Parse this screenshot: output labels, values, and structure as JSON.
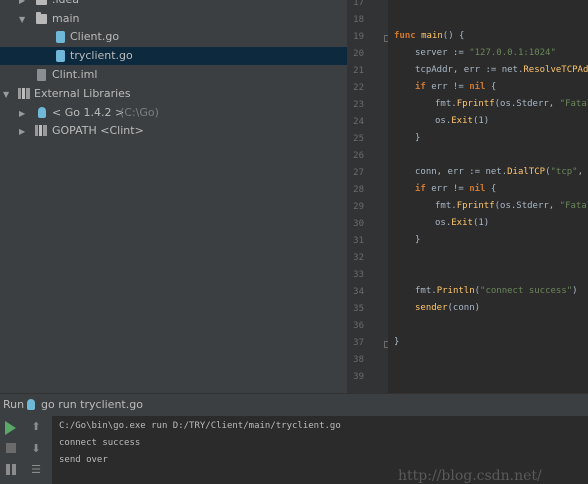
{
  "tree": {
    "items": [
      {
        "label": ".idea",
        "sub": ""
      },
      {
        "label": "main",
        "sub": ""
      },
      {
        "label": "Client.go",
        "sub": ""
      },
      {
        "label": "tryclient.go",
        "sub": ""
      },
      {
        "label": "Clint.iml",
        "sub": ""
      },
      {
        "label": "External Libraries",
        "sub": ""
      },
      {
        "label": "< Go 1.4.2 >",
        "sub": "(C:\\Go)"
      },
      {
        "label": "GOPATH <Clint>",
        "sub": ""
      }
    ]
  },
  "editor": {
    "line_numbers": [
      "17",
      "18",
      "19",
      "20",
      "21",
      "22",
      "23",
      "24",
      "25",
      "26",
      "27",
      "28",
      "29",
      "30",
      "31",
      "32",
      "33",
      "34",
      "35",
      "36",
      "37",
      "38",
      "39"
    ]
  },
  "run": {
    "label": "Run",
    "config": "go run tryclient.go",
    "console": [
      "C:/Go\\bin\\go.exe run D:/TRY/Client/main/tryclient.go",
      "connect success",
      "send over"
    ]
  },
  "watermark": "http://blog.csdn.net/"
}
